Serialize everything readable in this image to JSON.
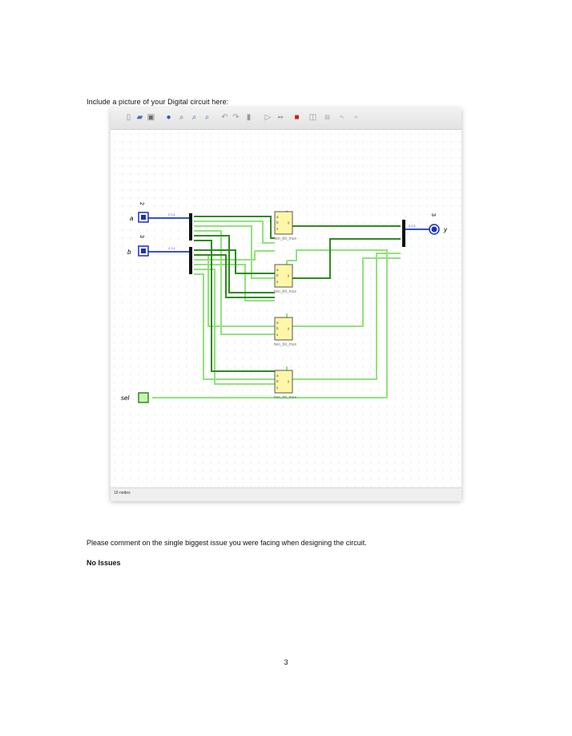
{
  "heading": "Include a picture of your Digital circuit here:",
  "toolbar": {
    "icons": [
      "new-file-icon",
      "open-folder-icon",
      "save-icon",
      "info-icon",
      "zoom-in-icon",
      "zoom-out-icon",
      "zoom-fit-icon",
      "undo-icon",
      "redo-icon",
      "delete-icon",
      "run-icon",
      "step-icon",
      "stop-icon",
      "analyse-icon",
      "table-icon",
      "expression-icon"
    ]
  },
  "circuit": {
    "inputs": [
      {
        "label": "a",
        "bits": "2"
      },
      {
        "label": "b",
        "bits": "3"
      },
      {
        "label": "sel",
        "bits": ""
      }
    ],
    "output": {
      "label": "y",
      "bits": "3"
    },
    "mux_label": "two_bit_mux",
    "mux_ports": {
      "a": "a",
      "b": "b",
      "s": "s",
      "y": "y"
    },
    "colors": {
      "wire_high": "#2f8a1d",
      "wire_low": "#8fe37a",
      "bus": "#3a4fd0",
      "component": "#fff7a8",
      "input_high": "#1a2ec8"
    }
  },
  "status_text": "16 nodes",
  "question": "Please comment on the single biggest issue you were facing when designing the circuit.",
  "answer": "No Issues",
  "page_number": "3"
}
